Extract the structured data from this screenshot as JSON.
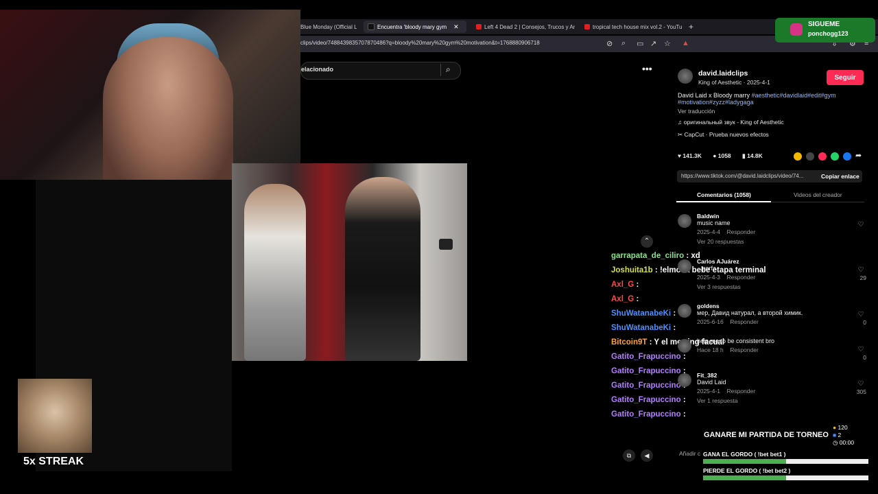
{
  "tabs": [
    {
      "label": "Blue Monday (Official L",
      "active": false
    },
    {
      "label": "Encuentra 'bloody mary gym",
      "active": true
    },
    {
      "label": "Left 4 Dead 2 | Consejos, Trucos y Ar",
      "active": false
    },
    {
      "label": "tropical tech house mix vol.2 - YouTu",
      "active": false
    }
  ],
  "address": {
    "url": "clips/video/7488439835707870486?q=bloody%20mary%20gym%20motivation&t=1768880906718"
  },
  "search": {
    "placeholder": "elacionado"
  },
  "overlay": {
    "sigueme_title": "SIGUEME",
    "sigueme_handle": "ponchogg123",
    "streak": "5x STREAK"
  },
  "chat": [
    {
      "user": "garrapata_de_ciliro",
      "color": "#8ce28c",
      "msg": ": xd"
    },
    {
      "user": "Joshuita1b",
      "color": "#d6e24a",
      "msg": ": !elmo la bebe etapa terminal"
    },
    {
      "user": "Axl_G",
      "color": "#ff4a4a",
      "msg": ":"
    },
    {
      "user": "Axl_G",
      "color": "#ff4a4a",
      "msg": ":"
    },
    {
      "user": "ShuWatanabeKi",
      "color": "#4a90ff",
      "msg": ":"
    },
    {
      "user": "ShuWatanabeKi",
      "color": "#4a90ff",
      "msg": ":"
    },
    {
      "user": "Bitcoin9T",
      "color": "#ffa23a",
      "msg": ": Y el mewing facual"
    },
    {
      "user": "Gatito_Frapuccino",
      "color": "#b47cff",
      "msg": ":"
    },
    {
      "user": "Gatito_Frapuccino",
      "color": "#b47cff",
      "msg": ":"
    },
    {
      "user": "Gatito_Frapuccino",
      "color": "#b47cff",
      "msg": ":"
    },
    {
      "user": "Gatito_Frapuccino",
      "color": "#b47cff",
      "msg": ":"
    },
    {
      "user": "Gatito_Frapuccino",
      "color": "#b47cff",
      "msg": ":"
    }
  ],
  "video_info": {
    "author": "david.laidclips",
    "subtitle": "King of Aesthetic · 2025-4-1",
    "follow": "Seguir",
    "desc_text": "David Laid x Bloody marry",
    "desc_tags_1": "#aesthetic#davidlaid#edit#gym",
    "desc_tags_2": "#motivation#zyzz#ladygaga",
    "translate": "Ver traducción",
    "sound": "оригинальный звук - King of Aesthetic",
    "capcut": "CapCut · Prueba nuevos efectos",
    "likes": "141.3K",
    "comments": "1058",
    "saves": "14.8K",
    "link": "https://www.tiktok.com/@david.laidclips/video/74...",
    "copy": "Copiar enlace",
    "tab_comments": "Comentarios (1058)",
    "tab_creator": "Videos del creador"
  },
  "comments": [
    {
      "name": "Baldwin",
      "text": "music name",
      "meta": "2025-4-4",
      "reply": "Responder",
      "more": "Ver 20 respuestas",
      "likes": ""
    },
    {
      "name": "Carlos AJuárez",
      "text": "...porfa",
      "meta": "2025-4-3",
      "reply": "Responder",
      "more": "Ver 3 respuestas",
      "likes": "29"
    },
    {
      "name": "goldens",
      "text": "мер, Давид натурал, а второй химик.",
      "meta": "2025-6-16",
      "reply": "Responder",
      "more": "",
      "likes": "0"
    },
    {
      "name": "",
      "text": "help me to be consistent bro",
      "meta": "Hace 18 h",
      "reply": "Responder",
      "more": "",
      "likes": "0"
    },
    {
      "name": "Fit_382",
      "text": "David Laid",
      "meta": "2025-4-1",
      "reply": "Responder",
      "more": "Ver 1 respuesta",
      "likes": "305"
    }
  ],
  "add_comment": "Añadir c",
  "prediction": {
    "title": "GANARE MI PARTIDA DE TORNEO",
    "points": "120",
    "people": "2",
    "time": "00:00",
    "option1": "GANA EL GORDO ( !bet bet1 )",
    "option2": "PIERDE EL GORDO ( !bet bet2 )",
    "option1_fill": 0.5,
    "option2_fill": 0.5
  }
}
